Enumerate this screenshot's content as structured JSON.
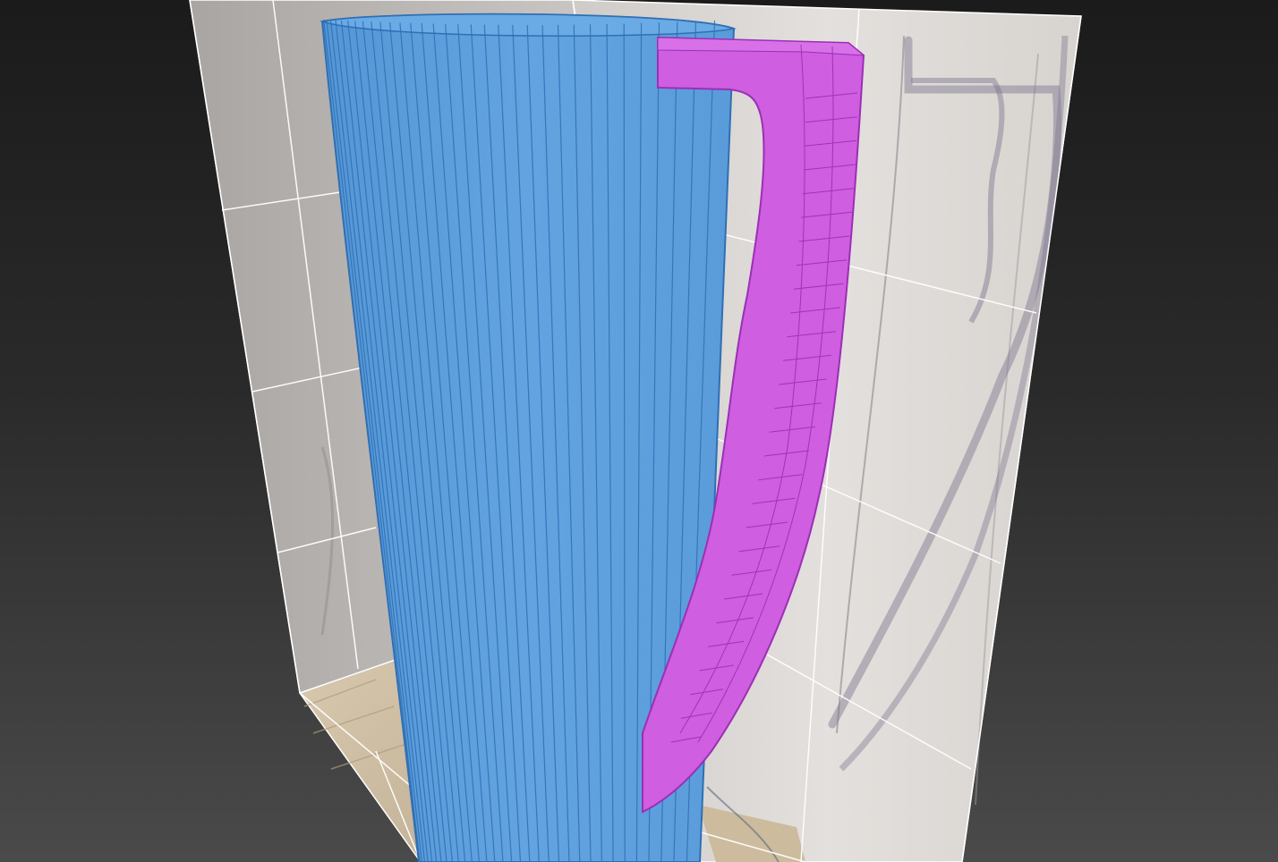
{
  "viewport": {
    "background_top": "#1b1b1b",
    "background_bottom": "#4a4a4a",
    "grid_color": "#ffffff"
  },
  "objects": [
    {
      "kind": "cylinder",
      "role": "mug-body",
      "color": "#5b9fdc",
      "edge_color": "#2f6fb4",
      "state": "unselected"
    },
    {
      "kind": "extruded-shape",
      "role": "mug-handle",
      "color": "#cf5ee0",
      "edge_color": "#9b2fb5",
      "state": "selected"
    }
  ],
  "reference_image": {
    "description_icon": "photo-reference-plane",
    "tones": [
      "#d9d6d4",
      "#b8b3ae",
      "#cdbfa8"
    ]
  }
}
